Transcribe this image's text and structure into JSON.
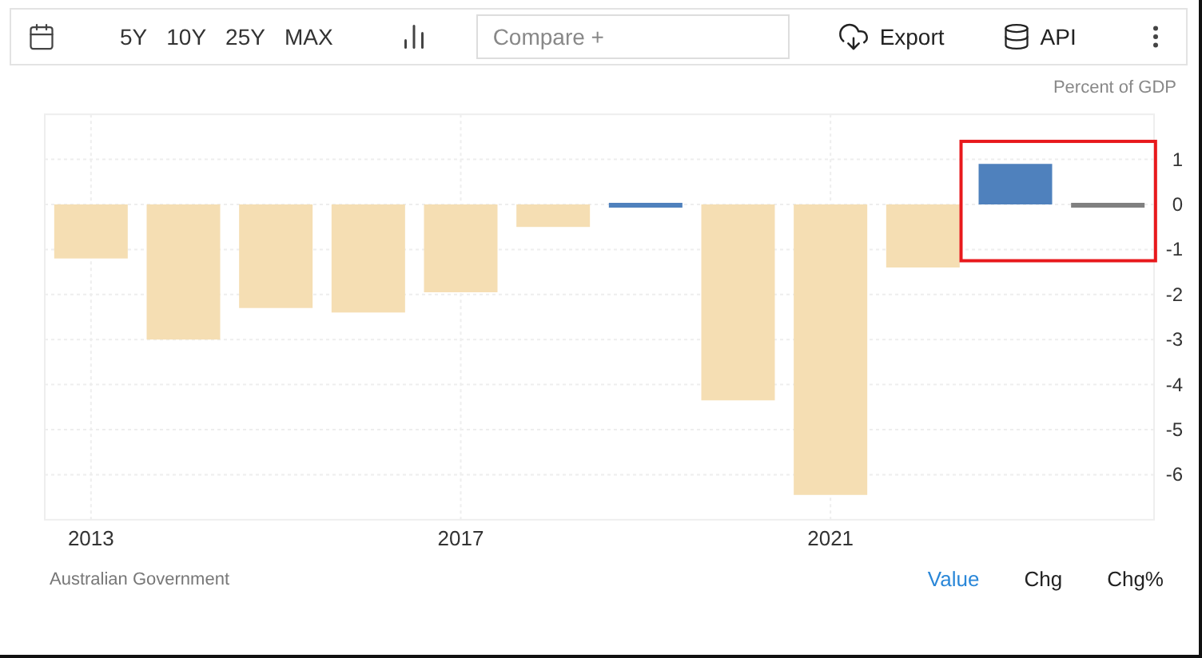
{
  "toolbar": {
    "ranges": [
      {
        "label": "5Y",
        "selected": false
      },
      {
        "label": "10Y",
        "selected": false
      },
      {
        "label": "25Y",
        "selected": false
      },
      {
        "label": "MAX",
        "selected": false
      }
    ],
    "compare": {
      "placeholder": "Compare +"
    },
    "export": "Export",
    "api": "API"
  },
  "chart": {
    "unit": "Percent of GDP",
    "frame": {
      "shown": true,
      "color": "#e8191c"
    },
    "chart_data": {
      "type": "bar",
      "x": [
        2013,
        2014,
        2015,
        2016,
        2017,
        2018,
        2019,
        2020,
        2021,
        2022,
        2023,
        2024
      ],
      "series": [
        {
          "color": "#f5deb3",
          "values": [
            -1.2,
            -3.0,
            -2.3,
            -2.4,
            -1.95,
            -0.5,
            null,
            -4.35,
            -6.45,
            -1.4,
            null,
            null
          ]
        },
        {
          "color": "#4f81bd",
          "values": [
            null,
            null,
            null,
            null,
            null,
            null,
            0.05,
            null,
            null,
            null,
            0.9,
            null
          ]
        },
        {
          "color": "#808080",
          "values": [
            null,
            null,
            null,
            null,
            null,
            null,
            null,
            null,
            null,
            null,
            null,
            -0.1
          ]
        }
      ],
      "xlim": [
        2012.5,
        2024.5
      ],
      "ylim": [
        -7,
        2
      ],
      "yticks": [
        {
          "value": 1,
          "label": "1"
        },
        {
          "value": 0,
          "label": "0"
        },
        {
          "value": -1,
          "label": "-1"
        },
        {
          "value": -2,
          "label": "-2"
        },
        {
          "value": -3,
          "label": "-3"
        },
        {
          "value": -4,
          "label": "-4"
        },
        {
          "value": -5,
          "label": "-5"
        },
        {
          "value": -6,
          "label": "-6"
        }
      ],
      "xticks": [
        2013,
        2017,
        2021
      ],
      "grid": true
    }
  },
  "footer": {
    "source": "Australian Government",
    "views": [
      {
        "label": "Value",
        "selected": true
      },
      {
        "label": "Chg",
        "selected": false
      },
      {
        "label": "Chg%",
        "selected": false
      }
    ]
  }
}
